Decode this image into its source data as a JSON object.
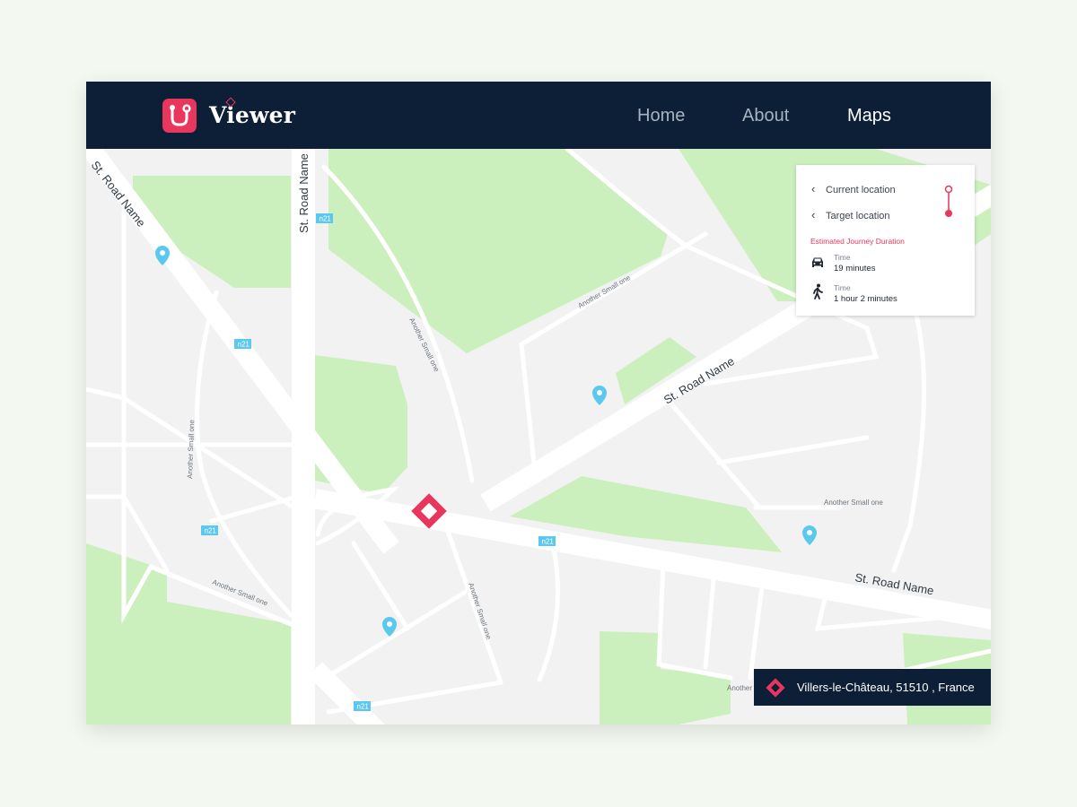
{
  "header": {
    "brand": "Viewer",
    "logo_icon": "route-logo-icon",
    "nav": [
      {
        "label": "Home",
        "active": false
      },
      {
        "label": "About",
        "active": false
      },
      {
        "label": "Maps",
        "active": true
      }
    ]
  },
  "map": {
    "road_labels": {
      "top_left_diagonal": "St. Road Name",
      "vertical": "St. Road Name",
      "diagonal_center": "St. Road Name",
      "main_horizontal": "St. Road Name"
    },
    "small_road_label": "Another Small one",
    "small_road_label_partial": "Another",
    "route_tag": "n21",
    "marker_icon": "map-pin-icon",
    "center_marker_icon": "diamond-location-icon"
  },
  "journey_panel": {
    "current_location": "Current location",
    "target_location": "Target location",
    "estimated_title": "Estimated Journey Duration",
    "car": {
      "icon": "car-icon",
      "label": "Time",
      "value": "19 minutes"
    },
    "walk": {
      "icon": "walking-person-icon",
      "label": "Time",
      "value": "1 hour 2 minutes"
    }
  },
  "address": {
    "icon": "diamond-location-icon",
    "text": "Villers-le-Château, 51510 , France"
  },
  "colors": {
    "navbar": "#0c1f37",
    "accent": "#e8365d",
    "park": "#cbefbd",
    "pin": "#5bc8f0",
    "land": "#f2f2f2"
  }
}
